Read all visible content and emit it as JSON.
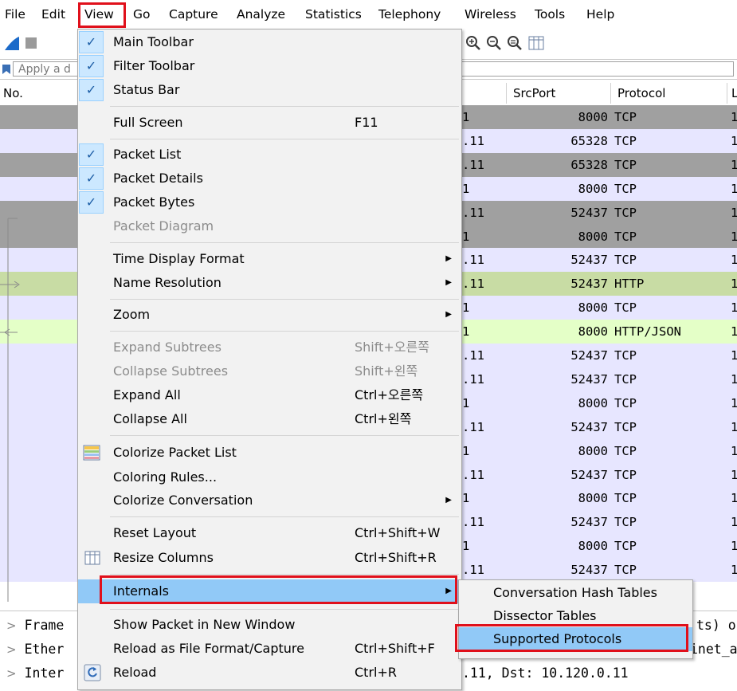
{
  "menubar": {
    "items": [
      {
        "label": "File"
      },
      {
        "label": "Edit"
      },
      {
        "label": "View"
      },
      {
        "label": "Go"
      },
      {
        "label": "Capture"
      },
      {
        "label": "Analyze"
      },
      {
        "label": "Statistics"
      },
      {
        "label": "Telephony"
      },
      {
        "label": "Wireless"
      },
      {
        "label": "Tools"
      },
      {
        "label": "Help"
      }
    ]
  },
  "filter": {
    "placeholder": "Apply a d"
  },
  "columns": {
    "no": "No.",
    "srcport": "SrcPort",
    "protocol": "Protocol",
    "more": "L"
  },
  "rows": [
    {
      "src": "1",
      "srcport": "8000",
      "protocol": "TCP",
      "tail": "1"
    },
    {
      "src": ".11",
      "srcport": "65328",
      "protocol": "TCP",
      "tail": "1"
    },
    {
      "src": ".11",
      "srcport": "65328",
      "protocol": "TCP",
      "tail": "1"
    },
    {
      "src": "1",
      "srcport": "8000",
      "protocol": "TCP",
      "tail": "1"
    },
    {
      "src": ".11",
      "srcport": "52437",
      "protocol": "TCP",
      "tail": "1"
    },
    {
      "src": "1",
      "srcport": "8000",
      "protocol": "TCP",
      "tail": "1"
    },
    {
      "src": ".11",
      "srcport": "52437",
      "protocol": "TCP",
      "tail": "1"
    },
    {
      "src": ".11",
      "srcport": "52437",
      "protocol": "HTTP",
      "tail": "1"
    },
    {
      "src": "1",
      "srcport": "8000",
      "protocol": "TCP",
      "tail": "1"
    },
    {
      "src": "1",
      "srcport": "8000",
      "protocol": "HTTP/JSON",
      "tail": "1"
    },
    {
      "src": ".11",
      "srcport": "52437",
      "protocol": "TCP",
      "tail": "1"
    },
    {
      "src": ".11",
      "srcport": "52437",
      "protocol": "TCP",
      "tail": "1"
    },
    {
      "src": "1",
      "srcport": "8000",
      "protocol": "TCP",
      "tail": "1"
    },
    {
      "src": ".11",
      "srcport": "52437",
      "protocol": "TCP",
      "tail": "1"
    },
    {
      "src": "1",
      "srcport": "8000",
      "protocol": "TCP",
      "tail": "1"
    },
    {
      "src": ".11",
      "srcport": "52437",
      "protocol": "TCP",
      "tail": "1"
    },
    {
      "src": "1",
      "srcport": "8000",
      "protocol": "TCP",
      "tail": "1"
    },
    {
      "src": ".11",
      "srcport": "52437",
      "protocol": "TCP",
      "tail": "1"
    },
    {
      "src": "1",
      "srcport": "8000",
      "protocol": "TCP",
      "tail": "1"
    },
    {
      "src": ".11",
      "srcport": "52437",
      "protocol": "TCP",
      "tail": "1"
    }
  ],
  "row_colors": {
    "gray": "#a0a0a0",
    "lavender": "#e7e6ff",
    "green": "#c8dca4",
    "lightgreen": "#e4ffc7"
  },
  "details": {
    "lines": [
      {
        "left": "Frame",
        "right": "ts) o"
      },
      {
        "left": "Ether",
        "right": "inet_a"
      },
      {
        "left": "Inter",
        "right": ".11, Dst: 10.120.0.11"
      }
    ]
  },
  "view_menu": {
    "main_toolbar": "Main Toolbar",
    "filter_toolbar": "Filter Toolbar",
    "status_bar": "Status Bar",
    "full_screen": "Full Screen",
    "full_screen_sc": "F11",
    "packet_list": "Packet List",
    "packet_details": "Packet Details",
    "packet_bytes": "Packet Bytes",
    "packet_diagram": "Packet Diagram",
    "time_display_format": "Time Display Format",
    "name_resolution": "Name Resolution",
    "zoom": "Zoom",
    "expand_subtrees": "Expand Subtrees",
    "expand_subtrees_sc": "Shift+오른쪽",
    "collapse_subtrees": "Collapse Subtrees",
    "collapse_subtrees_sc": "Shift+왼쪽",
    "expand_all": "Expand All",
    "expand_all_sc": "Ctrl+오른쪽",
    "collapse_all": "Collapse All",
    "collapse_all_sc": "Ctrl+왼쪽",
    "colorize_packet_list": "Colorize Packet List",
    "coloring_rules": "Coloring Rules...",
    "colorize_conversation": "Colorize Conversation",
    "reset_layout": "Reset Layout",
    "reset_layout_sc": "Ctrl+Shift+W",
    "resize_columns": "Resize Columns",
    "resize_columns_sc": "Ctrl+Shift+R",
    "internals": "Internals",
    "show_packet_window": "Show Packet in New Window",
    "reload_as_format": "Reload as File Format/Capture",
    "reload_as_format_sc": "Ctrl+Shift+F",
    "reload": "Reload",
    "reload_sc": "Ctrl+R"
  },
  "internals_submenu": {
    "conversation_hash_tables": "Conversation Hash Tables",
    "dissector_tables": "Dissector Tables",
    "supported_protocols": "Supported Protocols"
  },
  "colors": {
    "highlight": "#91c9f7",
    "check_bg": "#cce8ff",
    "annotation_red": "#e0101b"
  }
}
